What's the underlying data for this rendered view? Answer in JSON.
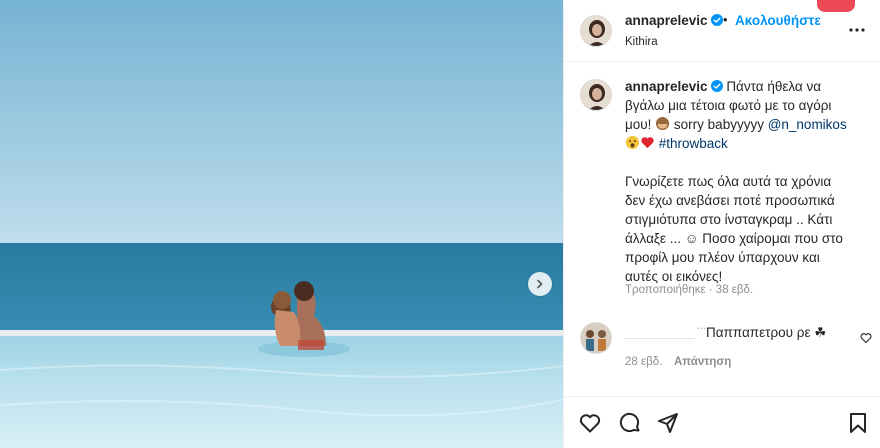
{
  "post": {
    "username": "annaprelevic",
    "follow_label": "Ακολουθήστε",
    "separator": "•",
    "location": "Kithira",
    "caption_line1": "Πάντα ήθελα να",
    "caption_line2": "βγάλω μια τέτοια φωτό με το αγόρι",
    "caption_line3a": "μου! ",
    "caption_line3b": " sorry babyyyyy ",
    "mention": "@n_nomikos",
    "hashtag": "#throwback",
    "caption_para2": "Γνωρίζετε πως όλα αυτά τα χρόνια\nδεν έχω ανεβάσει ποτέ προσωπικά\nστιγμιότυπα στο ίνσταγκραμ .. Κάτι\nάλλαξε ... ☺ Ποσο χαίρομαι που στο\nπροφίλ μου πλέον ύπαρχουν και\nαυτές οι εικόνες!",
    "edited": "Τροποποιήθηκε · 38 εβδ."
  },
  "comment": {
    "username_redacted": "___________ ˙˙˙",
    "text": "Παππαπετρου ρε ☘",
    "time": "28 εβδ.",
    "reply_label": "Απάντηση"
  },
  "icons": {
    "verified": "verified-badge-icon",
    "more": "more-options-icon",
    "next": "chevron-right-icon",
    "like": "heart-icon",
    "comment": "comment-icon",
    "share": "share-icon",
    "save": "bookmark-icon"
  },
  "colors": {
    "accent_blue": "#0095f6",
    "link": "#00376b",
    "muted": "#8e8e8e",
    "sea": "#2f7fa3",
    "sky": "#a9cfe2",
    "pool": "#bfe3ef"
  }
}
